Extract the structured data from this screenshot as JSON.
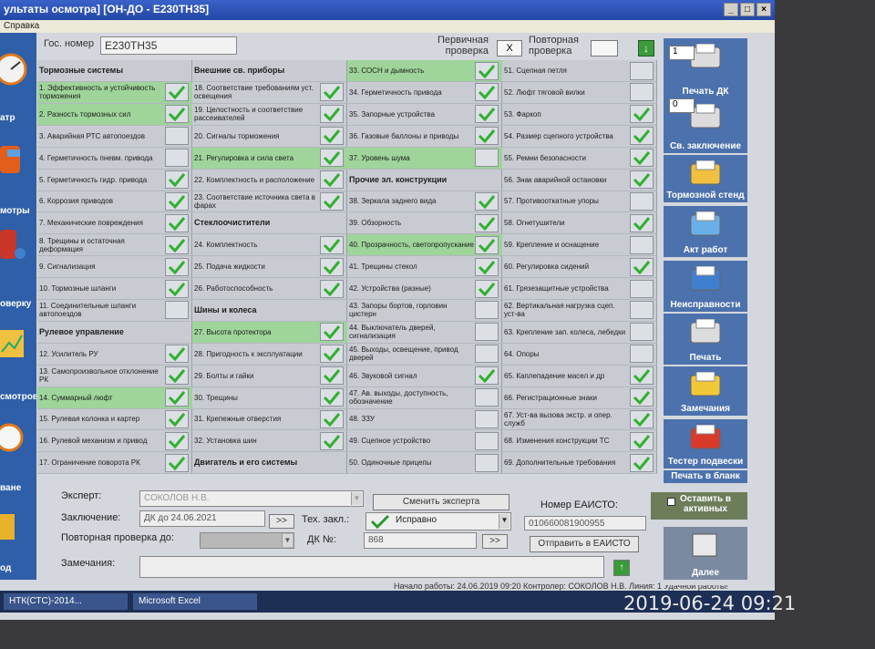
{
  "window": {
    "title": "ультаты осмотра] [ОН-ДО - Е230ТН35]",
    "menu": "Справка"
  },
  "left_strip": {
    "items": [
      "атр",
      "мотры",
      "оверку",
      "смотров",
      "ване",
      "од"
    ]
  },
  "header": {
    "gos_label": "Гос. номер",
    "gos_value": "Е230ТН35",
    "primary_label": "Первичная проверка",
    "primary_value": "X",
    "repeat_label": "Повторная проверка",
    "down_icon": "arrow-down-icon"
  },
  "checklist": {
    "columns": [
      [
        {
          "label": "Тормозные системы",
          "hdr": true,
          "hl": false,
          "check": "none"
        },
        {
          "label": "1. Эффективность и устойчивость торможения",
          "hdr": false,
          "hl": true,
          "check": "yes"
        },
        {
          "label": "2. Разность тормозных сил",
          "hdr": false,
          "hl": true,
          "check": "yes"
        },
        {
          "label": "3. Аварийная РТС автопоездов",
          "hdr": false,
          "hl": false,
          "check": "empty"
        },
        {
          "label": "4. Герметичность пневм. привода",
          "hdr": false,
          "hl": false,
          "check": "empty"
        },
        {
          "label": "5. Герметичность гидр. привода",
          "hdr": false,
          "hl": false,
          "check": "yes"
        },
        {
          "label": "6. Коррозия приводов",
          "hdr": false,
          "hl": false,
          "check": "yes"
        },
        {
          "label": "7. Механические повреждения",
          "hdr": false,
          "hl": false,
          "check": "yes"
        },
        {
          "label": "8. Трещины и остаточная деформация",
          "hdr": false,
          "hl": false,
          "check": "yes"
        },
        {
          "label": "9. Сигнализация",
          "hdr": false,
          "hl": false,
          "check": "yes"
        },
        {
          "label": "10. Тормозные шланги",
          "hdr": false,
          "hl": false,
          "check": "yes"
        },
        {
          "label": "11. Соединительные шланги автопоездов",
          "hdr": false,
          "hl": false,
          "check": "empty"
        },
        {
          "label": "Рулевое управление",
          "hdr": true,
          "hl": false,
          "check": "none"
        },
        {
          "label": "12. Усилитель РУ",
          "hdr": false,
          "hl": false,
          "check": "yes"
        },
        {
          "label": "13. Самопроизвольное отклонение РК",
          "hdr": false,
          "hl": false,
          "check": "yes"
        },
        {
          "label": "14. Суммарный люфт",
          "hdr": false,
          "hl": true,
          "check": "yes"
        },
        {
          "label": "15. Рулевая колонка и картер",
          "hdr": false,
          "hl": false,
          "check": "yes"
        },
        {
          "label": "16. Рулевой механизм и привод",
          "hdr": false,
          "hl": false,
          "check": "yes"
        },
        {
          "label": "17. Ограничение поворота РК",
          "hdr": false,
          "hl": false,
          "check": "yes"
        }
      ],
      [
        {
          "label": "Внешние св. приборы",
          "hdr": true,
          "hl": false,
          "check": "none"
        },
        {
          "label": "18. Соответствие требованиям уст. освещения",
          "hdr": false,
          "hl": false,
          "check": "yes"
        },
        {
          "label": "19. Целостность и соответствие рассеивателей",
          "hdr": false,
          "hl": false,
          "check": "yes"
        },
        {
          "label": "20. Сигналы торможения",
          "hdr": false,
          "hl": false,
          "check": "yes"
        },
        {
          "label": "21. Регулировка и сила света",
          "hdr": false,
          "hl": true,
          "check": "yes"
        },
        {
          "label": "22. Комплектность и расположение",
          "hdr": false,
          "hl": false,
          "check": "yes"
        },
        {
          "label": "23. Соответствие источника света в фарах",
          "hdr": false,
          "hl": false,
          "check": "yes"
        },
        {
          "label": "Стеклоочистители",
          "hdr": true,
          "hl": false,
          "check": "none"
        },
        {
          "label": "24. Комплектность",
          "hdr": false,
          "hl": false,
          "check": "yes"
        },
        {
          "label": "25. Подача жидкости",
          "hdr": false,
          "hl": false,
          "check": "yes"
        },
        {
          "label": "26. Работоспособность",
          "hdr": false,
          "hl": false,
          "check": "yes"
        },
        {
          "label": "Шины и колеса",
          "hdr": true,
          "hl": false,
          "check": "none"
        },
        {
          "label": "27. Высота протектора",
          "hdr": false,
          "hl": true,
          "check": "yes"
        },
        {
          "label": "28. Пригодность к эксплуатации",
          "hdr": false,
          "hl": false,
          "check": "yes"
        },
        {
          "label": "29. Болты и гайки",
          "hdr": false,
          "hl": false,
          "check": "yes"
        },
        {
          "label": "30. Трещины",
          "hdr": false,
          "hl": false,
          "check": "yes"
        },
        {
          "label": "31. Крепежные отверстия",
          "hdr": false,
          "hl": false,
          "check": "yes"
        },
        {
          "label": "32. Установка шин",
          "hdr": false,
          "hl": false,
          "check": "yes"
        },
        {
          "label": "Двигатель и его системы",
          "hdr": true,
          "hl": false,
          "check": "none"
        }
      ],
      [
        {
          "label": "33. СОСН и дымность",
          "hdr": false,
          "hl": true,
          "check": "yes"
        },
        {
          "label": "34. Герметичность привода",
          "hdr": false,
          "hl": false,
          "check": "yes"
        },
        {
          "label": "35. Запорные устройства",
          "hdr": false,
          "hl": false,
          "check": "yes"
        },
        {
          "label": "36. Газовые баллоны и приводы",
          "hdr": false,
          "hl": false,
          "check": "yes"
        },
        {
          "label": "37. Уровень шума",
          "hdr": false,
          "hl": true,
          "check": "empty"
        },
        {
          "label": "Прочие эл. конструкции",
          "hdr": true,
          "hl": false,
          "check": "none"
        },
        {
          "label": "38. Зеркала заднего вида",
          "hdr": false,
          "hl": false,
          "check": "yes"
        },
        {
          "label": "39. Обзорность",
          "hdr": false,
          "hl": false,
          "check": "yes"
        },
        {
          "label": "40. Прозрачность, светопропускание",
          "hdr": false,
          "hl": true,
          "check": "yes"
        },
        {
          "label": "41. Трещины стекол",
          "hdr": false,
          "hl": false,
          "check": "yes"
        },
        {
          "label": "42. Устройства (разные)",
          "hdr": false,
          "hl": false,
          "check": "yes"
        },
        {
          "label": "43. Запоры бортов, горловин цистерн",
          "hdr": false,
          "hl": false,
          "check": "empty"
        },
        {
          "label": "44. Выключатель дверей, сигнализация",
          "hdr": false,
          "hl": false,
          "check": "empty"
        },
        {
          "label": "45. Выходы, освещение, привод дверей",
          "hdr": false,
          "hl": false,
          "check": "empty"
        },
        {
          "label": "46. Звуковой сигнал",
          "hdr": false,
          "hl": false,
          "check": "yes"
        },
        {
          "label": "47. Ав. выходы, доступность, обозначение",
          "hdr": false,
          "hl": false,
          "check": "empty"
        },
        {
          "label": "48. ЗЗУ",
          "hdr": false,
          "hl": false,
          "check": "empty"
        },
        {
          "label": "49. Сцепное устройство",
          "hdr": false,
          "hl": false,
          "check": "empty"
        },
        {
          "label": "50. Одиночные прицепы",
          "hdr": false,
          "hl": false,
          "check": "empty"
        }
      ],
      [
        {
          "label": "51. Сцепная петля",
          "hdr": false,
          "hl": false,
          "check": "empty"
        },
        {
          "label": "52. Люфт тяговой вилки",
          "hdr": false,
          "hl": false,
          "check": "empty"
        },
        {
          "label": "53. Фаркоп",
          "hdr": false,
          "hl": false,
          "check": "yes"
        },
        {
          "label": "54. Размер сцепного устройства",
          "hdr": false,
          "hl": false,
          "check": "yes"
        },
        {
          "label": "55. Ремни безопасности",
          "hdr": false,
          "hl": false,
          "check": "yes"
        },
        {
          "label": "56. Знак аварийной остановки",
          "hdr": false,
          "hl": false,
          "check": "yes"
        },
        {
          "label": "57. Противооткатные упоры",
          "hdr": false,
          "hl": false,
          "check": "empty"
        },
        {
          "label": "58. Огнетушители",
          "hdr": false,
          "hl": false,
          "check": "yes"
        },
        {
          "label": "59. Крепление и оснащение",
          "hdr": false,
          "hl": false,
          "check": "empty"
        },
        {
          "label": "60. Регулировка сидений",
          "hdr": false,
          "hl": false,
          "check": "yes"
        },
        {
          "label": "61. Грязезащитные устройства",
          "hdr": false,
          "hl": false,
          "check": "empty"
        },
        {
          "label": "62. Вертикальная нагрузка сцеп. уст-ва",
          "hdr": false,
          "hl": false,
          "check": "empty"
        },
        {
          "label": "63. Крепление зап. колеса, лебедки",
          "hdr": false,
          "hl": false,
          "check": "empty"
        },
        {
          "label": "64. Опоры",
          "hdr": false,
          "hl": false,
          "check": "empty"
        },
        {
          "label": "65. Каплепадение масел и др",
          "hdr": false,
          "hl": false,
          "check": "yes"
        },
        {
          "label": "66. Регистрационные знаки",
          "hdr": false,
          "hl": false,
          "check": "yes"
        },
        {
          "label": "67. Уст-ва вызова экстр. и опер. служб",
          "hdr": false,
          "hl": false,
          "check": "yes"
        },
        {
          "label": "68. Изменения конструкции ТС",
          "hdr": false,
          "hl": false,
          "check": "yes"
        },
        {
          "label": "69. Дополнительные требования",
          "hdr": false,
          "hl": false,
          "check": "yes"
        }
      ]
    ]
  },
  "form": {
    "expert_label": "Эксперт:",
    "expert_value": "СОКОЛОВ Н.В.",
    "change_expert_button": "Сменить эксперта",
    "conclusion_label": "Заключение:",
    "conclusion_value": "ДК до 24.06.2021",
    "conclusion_btn": ">>",
    "tech_label": "Тех. закл.:",
    "tech_value": "Исправно",
    "repeat_label": "Повторная проверка до:",
    "dk_label": "ДК №:",
    "dk_value": "868",
    "dk_btn": ">>",
    "eaisto_label": "Номер ЕАИСТО:",
    "eaisto_value": "010660081900955",
    "send_button": "Отправить в ЕАИСТО",
    "remarks_label": "Замечания:"
  },
  "status_bar": {
    "text": "Начало работы: 24.06.2019 09:20  Контролер: СОКОЛОВ Н.В.  Линия: 1  Удачной работы!"
  },
  "right_panel": {
    "print_dk_spin": "1",
    "concl_spin": "0",
    "buttons": [
      "Печать ДК",
      "Св. заключение",
      "Тормозной стенд",
      "Акт работ",
      "Неисправности",
      "Печать",
      "Замечания",
      "Тестер подвески",
      "Печать в бланк"
    ],
    "leave_active_label": "Оставить в активных",
    "next_label": "Далее"
  },
  "taskbar": {
    "items": [
      "НТК(СТС)-2014...",
      "Microsoft Excel"
    ]
  },
  "camera_stamp": "2019-06-24  09:21",
  "colors": {
    "green": "#30b030",
    "highlight": "#9fd49a",
    "panel": "#4c72ad"
  }
}
